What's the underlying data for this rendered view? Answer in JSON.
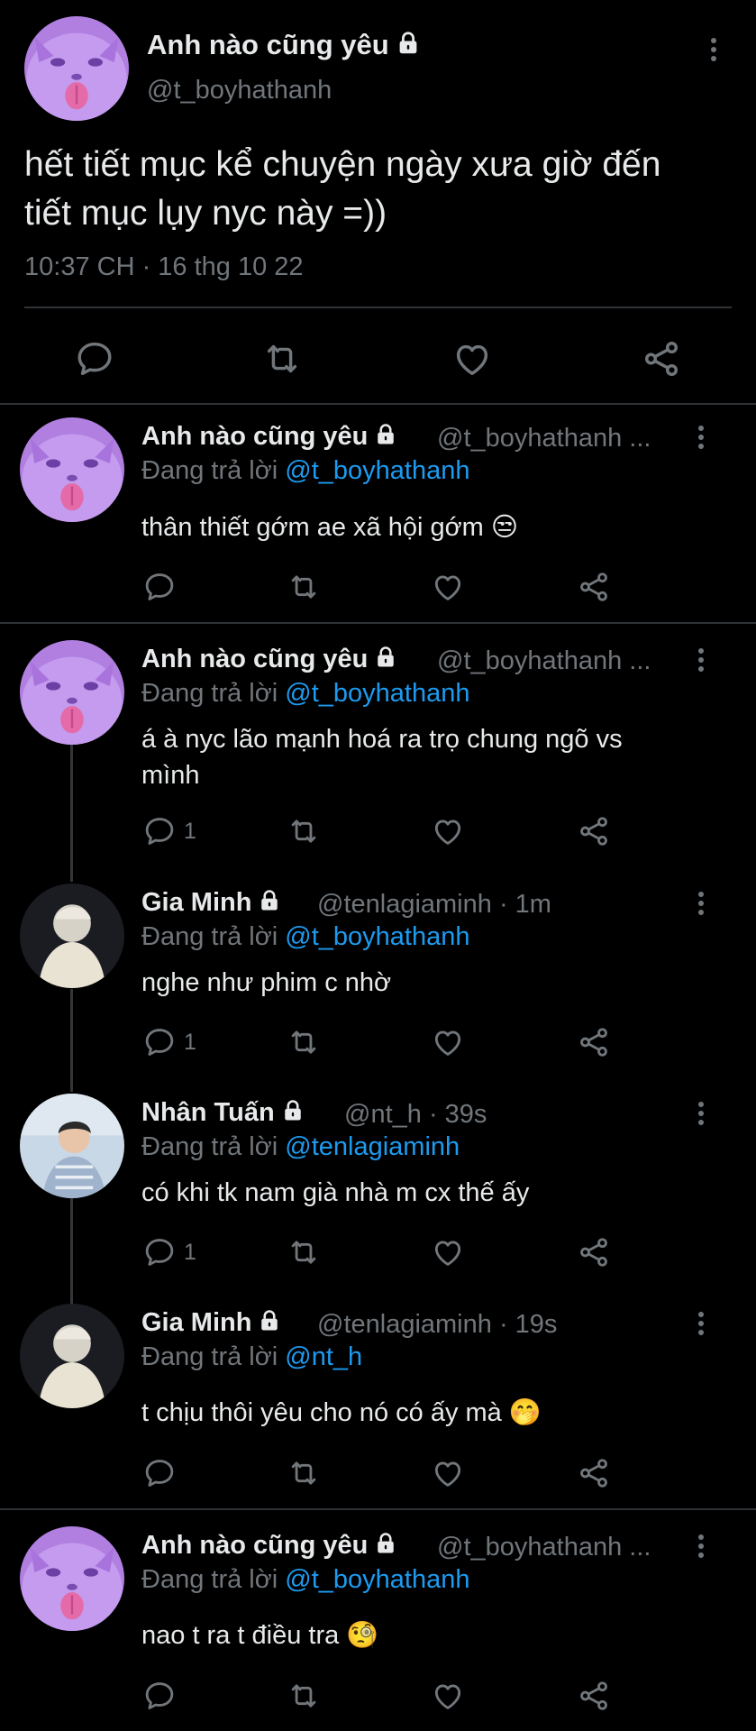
{
  "main": {
    "author_name": "Anh nào cũng yêu",
    "author_handle": "@t_boyhathanh",
    "text_line1": "hết tiết mục kể chuyện ngày xưa giờ đến",
    "text_line2": "tiết mục lụy nyc này =))",
    "timestamp": "10:37 CH · 16 thg 10 22"
  },
  "replies": [
    {
      "name": "Anh nào cũng yêu",
      "handle": "@t_boyhathanh ...",
      "replying_prefix": "Đang trả lời",
      "replying_to": "@t_boyhathanh",
      "text": "thân thiết gớm ae xã hội gớm 😒",
      "reply_count": ""
    },
    {
      "name": "Anh nào cũng yêu",
      "handle": "@t_boyhathanh ...",
      "replying_prefix": "Đang trả lời",
      "replying_to": "@t_boyhathanh",
      "text_line1": "á à nyc lão mạnh hoá ra trọ chung ngõ vs",
      "text_line2": "mình",
      "reply_count": "1"
    },
    {
      "name": "Gia Minh",
      "handle": "@tenlagiaminh · 1m",
      "replying_prefix": "Đang trả lời",
      "replying_to": "@t_boyhathanh",
      "text": "nghe như phim c nhờ",
      "reply_count": "1"
    },
    {
      "name": "Nhân Tuấn",
      "handle": "@nt_h · 39s",
      "replying_prefix": "Đang trả lời",
      "replying_to": "@tenlagiaminh",
      "text": "có khi tk nam già nhà m cx thế ấy",
      "reply_count": "1"
    },
    {
      "name": "Gia Minh",
      "handle": "@tenlagiaminh · 19s",
      "replying_prefix": "Đang trả lời",
      "replying_to": "@nt_h",
      "text": "t chịu thôi yêu cho nó có ấy mà 🤭",
      "reply_count": ""
    },
    {
      "name": "Anh nào cũng yêu",
      "handle": "@t_boyhathanh ...",
      "replying_prefix": "Đang trả lời",
      "replying_to": "@t_boyhathanh",
      "text": "nao t ra t điều tra 🧐",
      "reply_count": ""
    }
  ],
  "icons": {
    "reply": "reply-icon",
    "retweet": "retweet-icon",
    "like": "like-icon",
    "share": "share-icon",
    "more": "more-icon",
    "lock": "lock-icon"
  },
  "colors": {
    "background": "#000000",
    "text": "#e7e9ea",
    "muted": "#71767b",
    "link": "#1d9bf0",
    "divider": "#2f3336"
  }
}
